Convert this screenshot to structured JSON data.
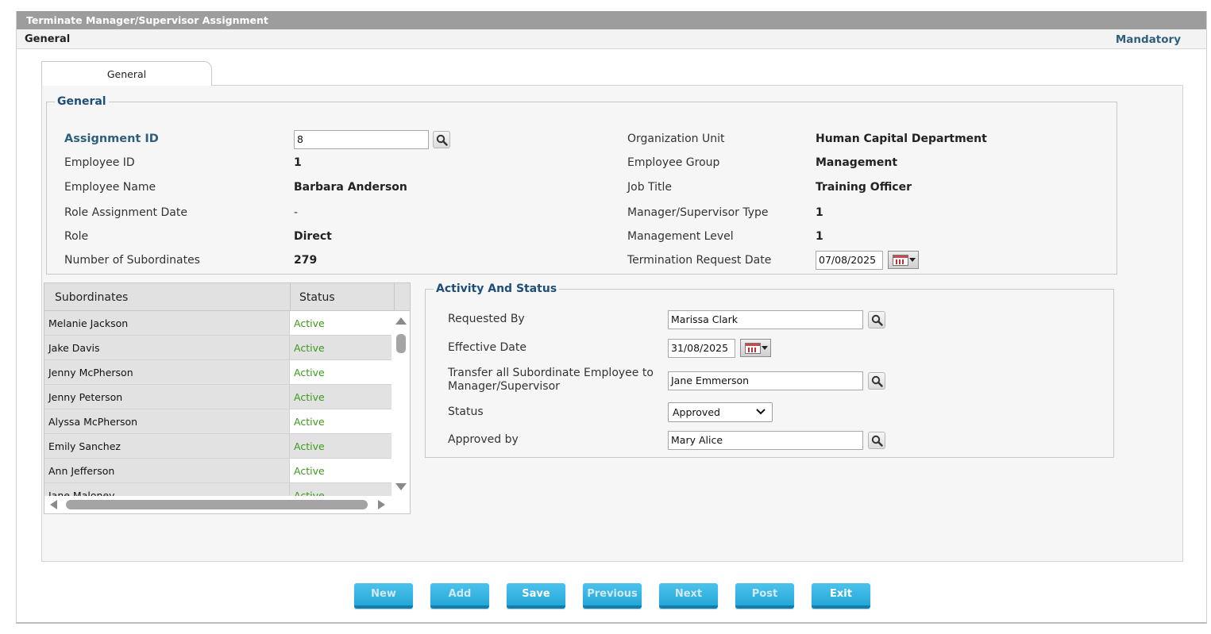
{
  "window": {
    "title": "Terminate Manager/Supervisor Assignment",
    "section_label": "General",
    "mandatory_label": "Mandatory"
  },
  "tabs": [
    {
      "label": "General",
      "active": true
    }
  ],
  "general": {
    "legend": "General",
    "assignment_id_label": "Assignment ID",
    "assignment_id_value": "8",
    "employee_id_label": "Employee ID",
    "employee_id_value": "1",
    "employee_name_label": "Employee Name",
    "employee_name_value": "Barbara Anderson",
    "role_assignment_date_label": "Role Assignment Date",
    "role_assignment_date_value": "-",
    "role_label": "Role",
    "role_value": "Direct",
    "num_subordinates_label": "Number of Subordinates",
    "num_subordinates_value": "279",
    "org_unit_label": "Organization Unit",
    "org_unit_value": "Human Capital Department",
    "employee_group_label": "Employee Group",
    "employee_group_value": "Management",
    "job_title_label": "Job Title",
    "job_title_value": "Training Officer",
    "mgr_type_label": "Manager/Supervisor Type",
    "mgr_type_value": "1",
    "mgmt_level_label": "Management Level",
    "mgmt_level_value": "1",
    "termination_date_label": "Termination Request Date",
    "termination_date_value": "07/08/2025"
  },
  "subordinates": {
    "columns": [
      "Subordinates",
      "Status"
    ],
    "rows": [
      {
        "name": "Melanie Jackson",
        "status": "Active"
      },
      {
        "name": "Jake Davis",
        "status": "Active"
      },
      {
        "name": "Jenny McPherson",
        "status": "Active"
      },
      {
        "name": "Jenny Peterson",
        "status": "Active"
      },
      {
        "name": "Alyssa McPherson",
        "status": "Active"
      },
      {
        "name": "Emily Sanchez",
        "status": "Active"
      },
      {
        "name": "Ann Jefferson",
        "status": "Active"
      },
      {
        "name": "Jane Maloney",
        "status": "Active"
      }
    ]
  },
  "activity": {
    "legend": "Activity And Status",
    "requested_by_label": "Requested By",
    "requested_by_value": "Marissa Clark",
    "effective_date_label": "Effective Date",
    "effective_date_value": "31/08/2025",
    "transfer_label_line1": "Transfer all Subordinate Employee to",
    "transfer_label_line2": "Manager/Supervisor",
    "transfer_value": "Jane Emmerson",
    "status_label": "Status",
    "status_value": "Approved",
    "approved_by_label": "Approved by",
    "approved_by_value": "Mary Alice"
  },
  "buttons": {
    "new": "New",
    "add": "Add",
    "save": "Save",
    "previous": "Previous",
    "next": "Next",
    "post": "Post",
    "exit": "Exit"
  },
  "icons": {
    "search": "search-icon",
    "calendar": "calendar-icon",
    "dropdown": "chevron-down-icon"
  },
  "colors": {
    "title_bar": "#9d9d9d",
    "accent_blue": "#2f5f7e",
    "button": "#26a6d8",
    "status_active": "#3a9a1a"
  }
}
